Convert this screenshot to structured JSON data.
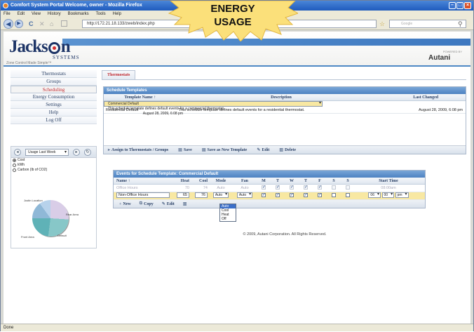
{
  "browser": {
    "title": "Comfort System Portal  Welcome, owner - Mozilla Firefox",
    "menu": [
      "File",
      "Edit",
      "View",
      "History",
      "Bookmarks",
      "Tools",
      "Help"
    ],
    "url": "http://172.21.18.133/zweb/index.php",
    "search_placeholder": "Google",
    "status": "Done"
  },
  "overlay": {
    "line1": "ENERGY",
    "line2": "USAGE"
  },
  "header": {
    "logo_main_a": "Jacks",
    "logo_main_b": "n",
    "logo_systems": "SYSTEMS",
    "tagline": "Zone Control Made Simple™",
    "powered": "POWERED BY",
    "partner": "Autani"
  },
  "sidebar": {
    "items": [
      "Thermostats",
      "Groups",
      "Scheduling",
      "Energy Consumption",
      "Settings",
      "Help",
      "Log Off"
    ],
    "active": "Scheduling"
  },
  "usage": {
    "range": "Usage Last Week",
    "options": [
      "Cost",
      "kWh",
      "Carbon (lb of CO2)"
    ],
    "selected": "Cost",
    "pie_labels": [
      "Justin Location",
      "Rear Area",
      "Front Area",
      "Default"
    ]
  },
  "tab": "Thermostats",
  "templates": {
    "title": "Schedule Templates",
    "headers": [
      "Template Name ↑",
      "Description",
      "Last Changed"
    ],
    "rows": [
      {
        "name": "Commercial Default",
        "desc": "This schedule template defines default events for a commercial thermostat.",
        "changed": "August 28, 2009, 6:08 pm"
      },
      {
        "name": "Residential Default",
        "desc": "This schedule template defines default events for a residential thermostat.",
        "changed": "August 28, 2009, 6:08 pm"
      }
    ],
    "toolbar": [
      "Assign to Thermostats / Groups",
      "Save",
      "Save as New Template",
      "Edit",
      "Delete"
    ]
  },
  "events": {
    "title": "Events for Schedule Template: Commercial Default",
    "headers": [
      "Name ↑",
      "Heat",
      "Cool",
      "Mode",
      "Fan",
      "M",
      "T",
      "W",
      "T",
      "F",
      "S",
      "S",
      "Start Time"
    ],
    "row1": {
      "name": "Office Hours",
      "heat": "70",
      "cool": "74",
      "mode": "Auto",
      "fan": "Auto",
      "start": "08:00am"
    },
    "row2": {
      "name": "Non-Office Hours",
      "heat": "65",
      "cool": "76",
      "mode": "Auto",
      "fan": "Auto",
      "hh": "06",
      "mm": "00",
      "ampm": "pm"
    },
    "mode_options": [
      "Auto",
      "Cool",
      "Heat",
      "Off"
    ],
    "toolbar": [
      "New",
      "Copy",
      "Edit"
    ]
  },
  "copyright": "© 2009, Autani Corporation. All Rights Reserved."
}
